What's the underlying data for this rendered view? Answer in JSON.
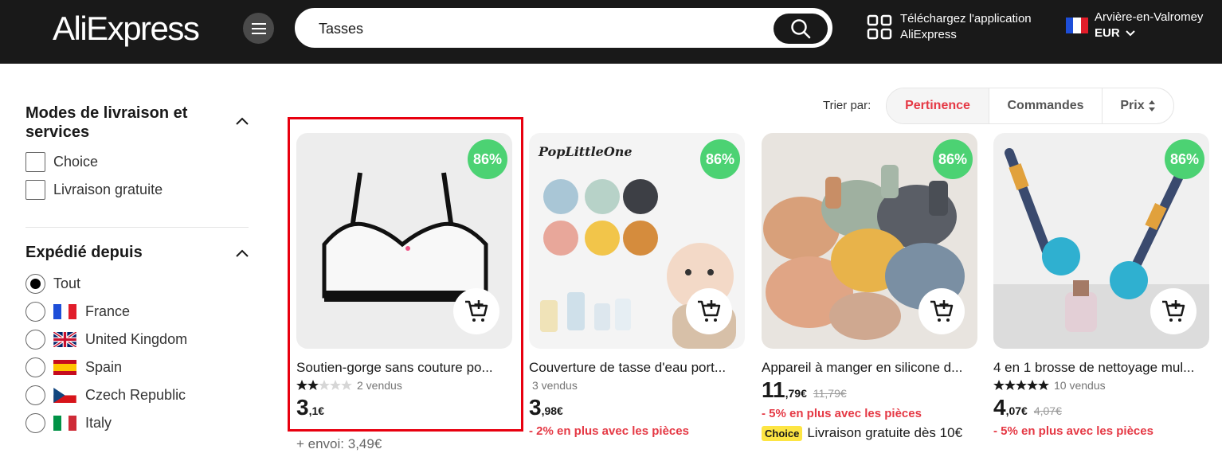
{
  "header": {
    "logo": "AliExpress",
    "search_value": "Tasses",
    "app_line1": "Téléchargez l'application",
    "app_line2": "AliExpress",
    "location": "Arvière-en-Valromey",
    "currency": "EUR",
    "bg_color": "#191919"
  },
  "sidebar": {
    "delivery_title": "Modes de livraison et services",
    "delivery_options": [
      "Choice",
      "Livraison gratuite"
    ],
    "shipped_from_title": "Expédié depuis",
    "shipped_from_options": [
      {
        "label": "Tout",
        "selected": true
      },
      {
        "label": "France",
        "flag": "fr"
      },
      {
        "label": "United Kingdom",
        "flag": "gb"
      },
      {
        "label": "Spain",
        "flag": "es"
      },
      {
        "label": "Czech Republic",
        "flag": "cz"
      },
      {
        "label": "Italy",
        "flag": "it"
      }
    ]
  },
  "sort": {
    "label": "Trier par:",
    "options": [
      "Pertinence",
      "Commandes",
      "Prix"
    ],
    "active": "Pertinence",
    "accent_color": "#e53945"
  },
  "products": [
    {
      "badge": "86%",
      "brand": "",
      "title": "Soutien-gorge sans couture po...",
      "rating": 2,
      "sold": "2 vendus",
      "price_int": "3",
      "price_dec": ",1€",
      "old_price": "",
      "promo": "",
      "shipping": "+ envoi: 3,49€",
      "choice": ""
    },
    {
      "badge": "86%",
      "brand": "PopLittleOne",
      "title": "Couverture de tasse d'eau port...",
      "rating": 0,
      "sold": "3 vendus",
      "price_int": "3",
      "price_dec": ",98€",
      "old_price": "",
      "promo": "- 2% en plus avec les pièces",
      "shipping": "",
      "choice": ""
    },
    {
      "badge": "86%",
      "brand": "",
      "title": "Appareil à manger en silicone d...",
      "rating": 0,
      "sold": "",
      "price_int": "11",
      "price_dec": ",79€",
      "old_price": "11,79€",
      "promo": "- 5% en plus avec les pièces",
      "shipping": "",
      "choice": "Choice",
      "choice_text": "Livraison gratuite dès 10€"
    },
    {
      "badge": "86%",
      "brand": "",
      "title": "4 en 1 brosse de nettoyage mul...",
      "rating": 5,
      "sold": "10 vendus",
      "price_int": "4",
      "price_dec": ",07€",
      "old_price": "4,07€",
      "promo": "- 5% en plus avec les pièces",
      "shipping": "",
      "choice": ""
    }
  ]
}
